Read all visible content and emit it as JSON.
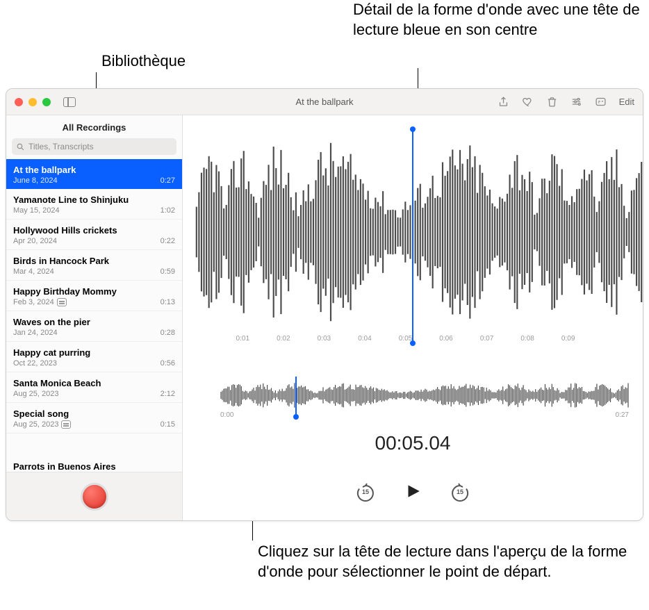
{
  "annotations": {
    "library": "Bibliothèque",
    "detail": "Détail de la forme d'onde avec une tête de lecture bleue en son centre",
    "overview": "Cliquez sur la tête de lecture dans l'aperçu de la forme d'onde pour sélectionner le point de départ."
  },
  "window": {
    "title": "At the ballpark",
    "edit": "Edit"
  },
  "sidebar": {
    "header": "All Recordings",
    "search_placeholder": "Titles, Transcripts",
    "items": [
      {
        "title": "At the ballpark",
        "date": "June 8, 2024",
        "duration": "0:27",
        "selected": true
      },
      {
        "title": "Yamanote Line to Shinjuku",
        "date": "May 15, 2024",
        "duration": "1:02"
      },
      {
        "title": "Hollywood Hills crickets",
        "date": "Apr 20, 2024",
        "duration": "0:22"
      },
      {
        "title": "Birds in Hancock Park",
        "date": "Mar 4, 2024",
        "duration": "0:59"
      },
      {
        "title": "Happy Birthday Mommy",
        "date": "Feb 3, 2024",
        "duration": "0:13",
        "transcript": true
      },
      {
        "title": "Waves on the pier",
        "date": "Jan 24, 2024",
        "duration": "0:28"
      },
      {
        "title": "Happy cat purring",
        "date": "Oct 22, 2023",
        "duration": "0:56"
      },
      {
        "title": "Santa Monica Beach",
        "date": "Aug 25, 2023",
        "duration": "2:12"
      },
      {
        "title": "Special song",
        "date": "Aug 25, 2023",
        "duration": "0:15",
        "transcript": true
      }
    ],
    "last_partial": "Parrots in Buenos Aires"
  },
  "timeline": {
    "ticks": [
      "",
      "0:01",
      "0:02",
      "0:03",
      "0:04",
      "0:05",
      "0:06",
      "0:07",
      "0:08",
      "0:09",
      ""
    ]
  },
  "overview": {
    "start": "0:00",
    "end": "0:27"
  },
  "time_display": "00:05.04",
  "skip_amount": "15"
}
